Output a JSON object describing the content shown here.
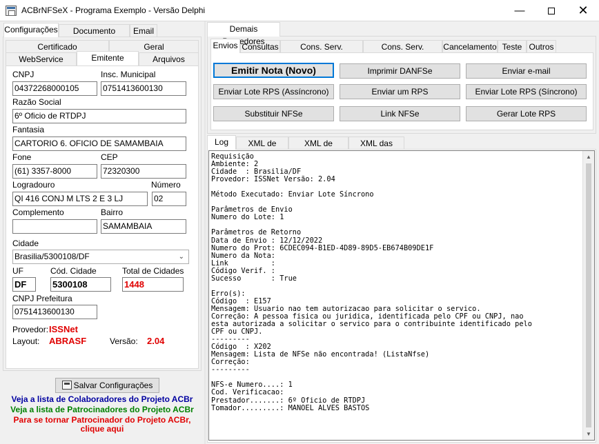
{
  "window": {
    "title": "ACBrNFSeX - Programa Exemplo - Versão Delphi",
    "min": "—",
    "close": "✕"
  },
  "left": {
    "tabs": [
      "Configurações",
      "Documento Auxiliar",
      "Email"
    ],
    "subtabs_row1": [
      "Certificado",
      "Geral"
    ],
    "subtabs_row2": [
      "WebService",
      "Emitente",
      "Arquivos"
    ],
    "fields": {
      "cnpj_label": "CNPJ",
      "cnpj": "04372268000105",
      "im_label": "Insc. Municipal",
      "im": "0751413600130",
      "razao_label": "Razão Social",
      "razao": "6º Oficio de RTDPJ",
      "fantasia_label": "Fantasia",
      "fantasia": "CARTORIO 6. OFICIO DE SAMAMBAIA",
      "fone_label": "Fone",
      "fone": "(61) 3357-8000",
      "cep_label": "CEP",
      "cep": "72320300",
      "logradouro_label": "Logradouro",
      "logradouro": "QI 416 CONJ M LTS 2 E 3 LJ",
      "numero_label": "Número",
      "numero": "02",
      "complemento_label": "Complemento",
      "complemento": "",
      "bairro_label": "Bairro",
      "bairro": "SAMAMBAIA",
      "cidade_label": "Cidade",
      "cidade": "Brasilia/5300108/DF",
      "uf_label": "UF",
      "uf": "DF",
      "codcidade_label": "Cód. Cidade",
      "codcidade": "5300108",
      "total_label": "Total de Cidades",
      "total": "1448",
      "cnpjpref_label": "CNPJ Prefeitura",
      "cnpjpref": "0751413600130"
    },
    "provedor_label": "Provedor:",
    "provedor": "ISSNet",
    "layout_label": "Layout:",
    "layout": "ABRASF",
    "versao_label": "Versão:",
    "versao": "2.04",
    "save_button": "Salvar Configurações",
    "links": {
      "colaboradores": "Veja a lista de Colaboradores do Projeto ACBr",
      "patrocinadores": "Veja a lista de Patrocinadores do Projeto ACBr",
      "tornar1": "Para se tornar Patrocinador do Projeto ACBr,",
      "tornar2": "clique aqui"
    },
    "colors": {
      "blue": "#0000a0",
      "green": "#008000",
      "red": "#e00000"
    }
  },
  "right": {
    "outer_tab": "Demais Provedores",
    "tabs": [
      "Envios",
      "Consultas",
      "Cons. Serv. Prestados",
      "Cons. Serv. Tomados",
      "Cancelamento",
      "Teste",
      "Outros"
    ],
    "buttons": {
      "emitir": "Emitir Nota (Novo)",
      "imprimir": "Imprimir DANFSe",
      "email": "Enviar e-mail",
      "lote_assinc": "Enviar Lote RPS (Assíncrono)",
      "um_rps": "Enviar um RPS",
      "lote_sinc": "Enviar Lote RPS (Síncrono)",
      "substituir": "Substituir NFSe",
      "link": "Link NFSe",
      "gerar": "Gerar Lote RPS"
    },
    "log_tabs": [
      "Log",
      "XML de Envio",
      "XML de Retorno",
      "XML das Notas"
    ],
    "log_lines": [
      "Requisição",
      "Ambiente: 2",
      "Cidade  : Brasilia/DF",
      "Provedor: ISSNet Versão: 2.04",
      "",
      "Método Executado: Enviar Lote Síncrono",
      "",
      "Parâmetros de Envio",
      "Numero do Lote: 1",
      "",
      "Parâmetros de Retorno",
      "Data de Envio : 12/12/2022",
      "Numero do Prot: 6CDEC094-B1ED-4D89-89D5-EB674B09DE1F",
      "Numero da Nota:",
      "Link          :",
      "Código Verif. :",
      "Sucesso       : True",
      "",
      "Erro(s):",
      "Código  : E157",
      "Mensagem: Usuario nao tem autorizacao para solicitar o servico.",
      "Correção: A pessoa fisica ou juridica, identificada pelo CPF ou CNPJ, nao",
      "esta autorizada a solicitar o servico para o contribuinte identificado pelo",
      "CPF ou CNPJ.",
      "---------",
      "Código  : X202",
      "Mensagem: Lista de NFSe não encontrada! (ListaNfse)",
      "Correção:",
      "---------",
      "",
      "NFS-e Numero....: 1",
      "Cod. Verificacao:",
      "Prestador.......: 6º Oficio de RTDPJ",
      "Tomador.........: MANOEL ALVES BASTOS"
    ]
  }
}
